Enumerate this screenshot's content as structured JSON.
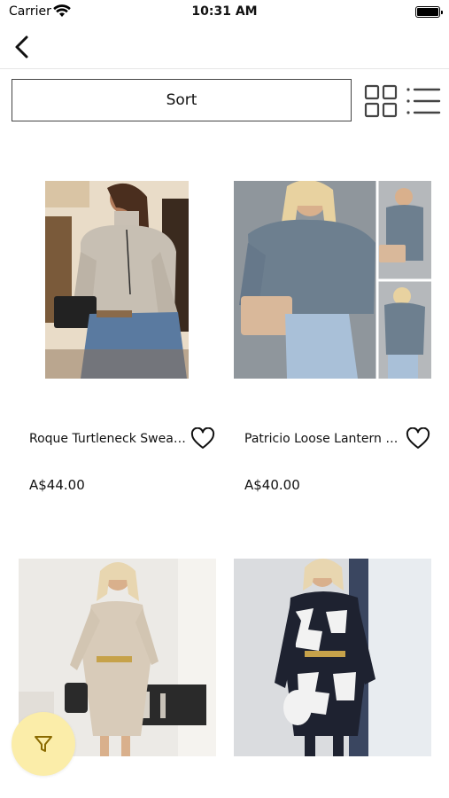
{
  "status_bar": {
    "carrier": "Carrier",
    "time": "10:31 AM"
  },
  "nav": {
    "back_icon": "chevron-left-icon"
  },
  "toolbar": {
    "sort_label": "Sort",
    "grid_icon": "grid-view-icon",
    "list_icon": "list-view-icon"
  },
  "products": [
    {
      "name": "Roque Turtleneck  Sweater",
      "price": "A$44.00",
      "favorited": false
    },
    {
      "name": "Patricio Loose  Lantern Sl...",
      "price": "A$40.00",
      "favorited": false
    },
    {
      "name": "",
      "price": "",
      "favorited": false
    },
    {
      "name": "",
      "price": "",
      "favorited": false
    }
  ],
  "filter_fab": {
    "icon": "filter-icon",
    "color": "#fbeda9",
    "icon_color": "#9a7a00"
  }
}
